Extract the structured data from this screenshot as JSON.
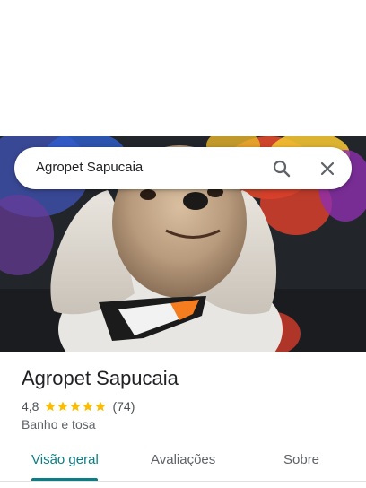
{
  "search": {
    "query": "Agropet Sapucaia",
    "search_icon": "search-icon",
    "close_icon": "close-icon"
  },
  "hero": {
    "alt": "Cachorro shih-tzu com bandana após banho e tosa"
  },
  "place": {
    "title": "Agropet Sapucaia",
    "rating": "4,8",
    "stars": 5,
    "review_count": "(74)",
    "category": "Banho e tosa"
  },
  "tabs": [
    {
      "label": "Visão geral",
      "active": true
    },
    {
      "label": "Avaliações",
      "active": false
    },
    {
      "label": "Sobre",
      "active": false
    }
  ],
  "colors": {
    "accent": "#0b7d84",
    "star": "#fbbc04",
    "text_primary": "#202124",
    "text_secondary": "#5f6368"
  }
}
